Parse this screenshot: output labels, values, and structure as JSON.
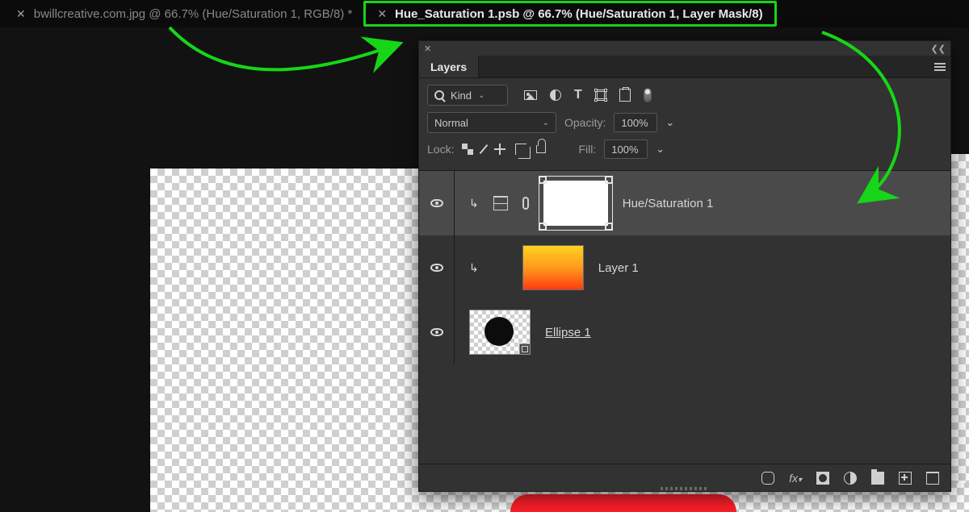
{
  "tabs": {
    "inactive": {
      "label": "bwillcreative.com.jpg @ 66.7% (Hue/Saturation 1, RGB/8) *"
    },
    "active": {
      "label": "Hue_Saturation 1.psb @ 66.7% (Hue/Saturation 1, Layer Mask/8)"
    }
  },
  "panel": {
    "tab": "Layers",
    "filter_kind": "Kind",
    "blend_mode": "Normal",
    "opacity_label": "Opacity:",
    "opacity_value": "100%",
    "lock_label": "Lock:",
    "fill_label": "Fill:",
    "fill_value": "100%"
  },
  "layers": [
    {
      "name": "Hue/Saturation 1"
    },
    {
      "name": "Layer 1"
    },
    {
      "name": "Ellipse 1"
    }
  ],
  "annotation": {
    "color": "#17d617"
  }
}
